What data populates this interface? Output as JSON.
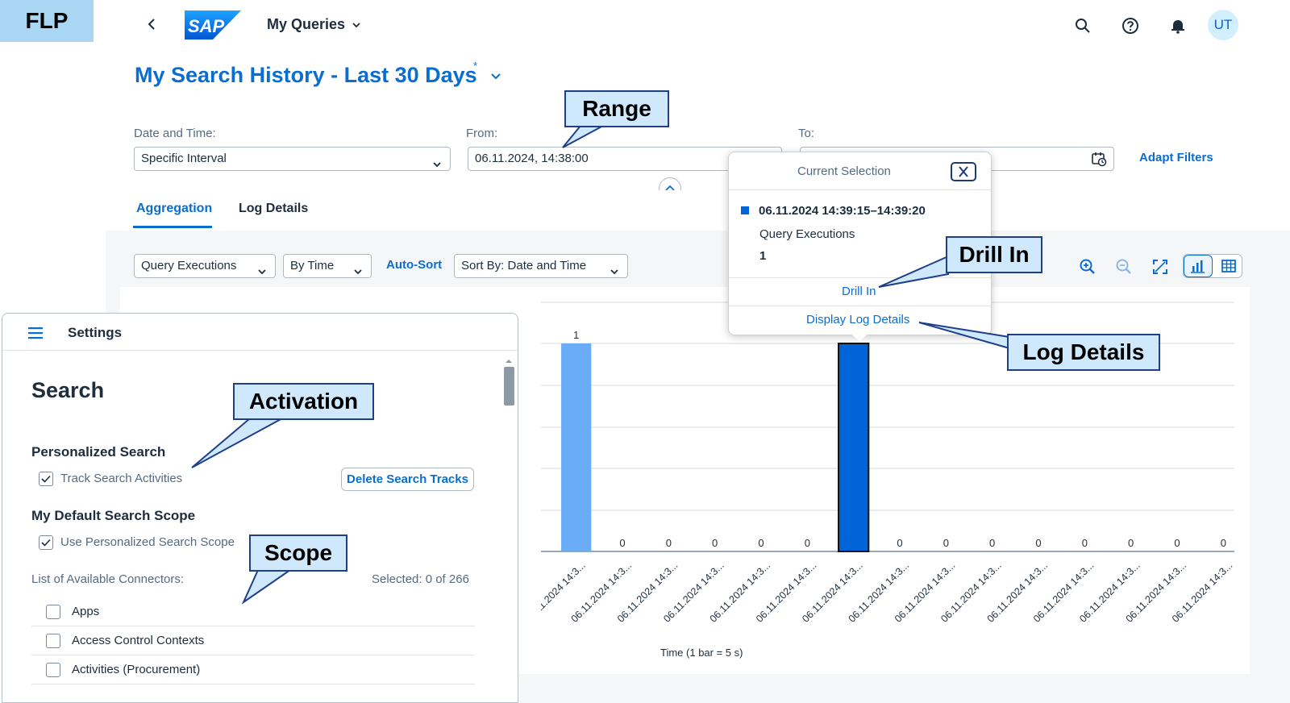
{
  "badge": "FLP",
  "shell": {
    "app_title": "My Queries",
    "avatar_initials": "UT",
    "icons": [
      "back-icon",
      "search-icon",
      "help-icon",
      "notification-bell-icon"
    ]
  },
  "page": {
    "title": "My Search History - Last 30 Days",
    "title_modified_marker": "*"
  },
  "filters": {
    "date_time_label": "Date and Time:",
    "date_time_value": "Specific Interval",
    "from_label": "From:",
    "from_value": "06.11.2024, 14:38:00",
    "to_label": "To:",
    "adapt_filters": "Adapt Filters"
  },
  "tabs": [
    {
      "label": "Aggregation",
      "selected": true
    },
    {
      "label": "Log Details",
      "selected": false
    }
  ],
  "toolbar": {
    "measure": "Query Executions",
    "dimension": "By Time",
    "auto_sort": "Auto-Sort",
    "sort_by": "Sort By: Date and Time",
    "icons": [
      "zoom-in-icon",
      "zoom-out-icon",
      "fullscreen-icon",
      "bar-chart-icon",
      "table-icon"
    ]
  },
  "chart_data": {
    "type": "bar",
    "xlabel": "Time (1 bar = 5 s)",
    "ylabel": "",
    "categories": [
      "06.11.2024 14:3...",
      "06.11.2024 14:3...",
      "06.11.2024 14:3...",
      "06.11.2024 14:3...",
      "06.11.2024 14:3...",
      "06.11.2024 14:3...",
      "06.11.2024 14:3...",
      "06.11.2024 14:3...",
      "06.11.2024 14:3...",
      "06.11.2024 14:3...",
      "06.11.2024 14:3...",
      "06.11.2024 14:3...",
      "06.11.2024 14:3...",
      "06.11.2024 14:3...",
      "06.11.2024 14:3..."
    ],
    "values": [
      1,
      0,
      0,
      0,
      0,
      0,
      1,
      0,
      0,
      0,
      0,
      0,
      0,
      0,
      0
    ],
    "selected_index": 6,
    "ylim": [
      0,
      1
    ],
    "grid": true,
    "colors": {
      "bar": "#6aadf6",
      "selected": "#0064d9"
    }
  },
  "popover": {
    "title": "Current Selection",
    "range": "06.11.2024 14:39:15–14:39:20",
    "measure": "Query Executions",
    "value": "1",
    "drill_in": "Drill In",
    "display_log": "Display Log Details"
  },
  "settings": {
    "header": "Settings",
    "section": "Search",
    "personalized_heading": "Personalized Search",
    "track_label": "Track Search Activities",
    "track_checked": true,
    "delete_button": "Delete Search Tracks",
    "scope_heading": "My Default Search Scope",
    "use_scope_label": "Use Personalized Search Scope",
    "use_scope_checked": true,
    "list_label": "List of Available Connectors:",
    "selected_count": "Selected: 0 of 266",
    "connectors": [
      {
        "label": "Apps",
        "checked": false
      },
      {
        "label": "Access Control Contexts",
        "checked": false
      },
      {
        "label": "Activities (Procurement)",
        "checked": false
      }
    ]
  },
  "callouts": {
    "range": "Range",
    "drill_in": "Drill In",
    "log_details": "Log Details",
    "activation": "Activation",
    "scope": "Scope"
  },
  "colors": {
    "brand_blue": "#0a6ed1",
    "badge_bg": "#a9d6f3",
    "callout_bg": "#cfe8fb",
    "callout_border": "#1f3f88"
  }
}
